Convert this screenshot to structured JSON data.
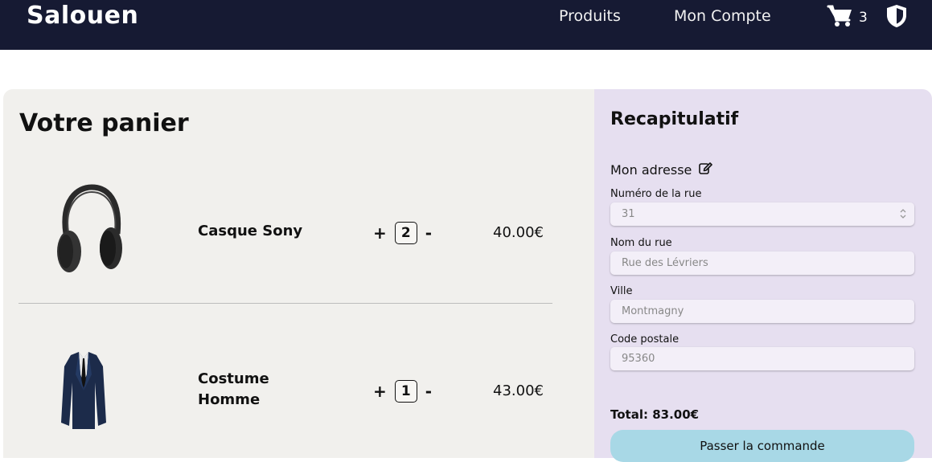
{
  "header": {
    "brand": "Salouen",
    "nav": {
      "products": "Produits",
      "account": "Mon Compte"
    },
    "cart_count": "3",
    "icons": {
      "cart": "cart-icon",
      "shield": "shield-icon"
    }
  },
  "cart": {
    "title": "Votre panier",
    "items": [
      {
        "name": "Casque Sony",
        "qty": "2",
        "price": "40.00€",
        "image": "headphones-image"
      },
      {
        "name_line1": "Costume",
        "name_line2": "Homme",
        "qty": "1",
        "price": "43.00€",
        "image": "suit-image"
      }
    ],
    "plus": "+",
    "minus": "-"
  },
  "summary": {
    "title": "Recapitulatif",
    "address_heading": "Mon adresse",
    "fields": [
      {
        "label": "Numéro de la rue",
        "value": "31"
      },
      {
        "label": "Nom du rue",
        "value": "Rue des Lévriers"
      },
      {
        "label": "Ville",
        "value": "Montmagny"
      },
      {
        "label": "Code postale",
        "value": "95360"
      }
    ],
    "total": "Total: 83.00€",
    "order_button": "Passer la commande"
  },
  "colors": {
    "header_bg": "#161a33",
    "cart_bg": "#f1f0ed",
    "summary_bg": "#e6dff0",
    "button_bg": "#a8d8e6"
  }
}
